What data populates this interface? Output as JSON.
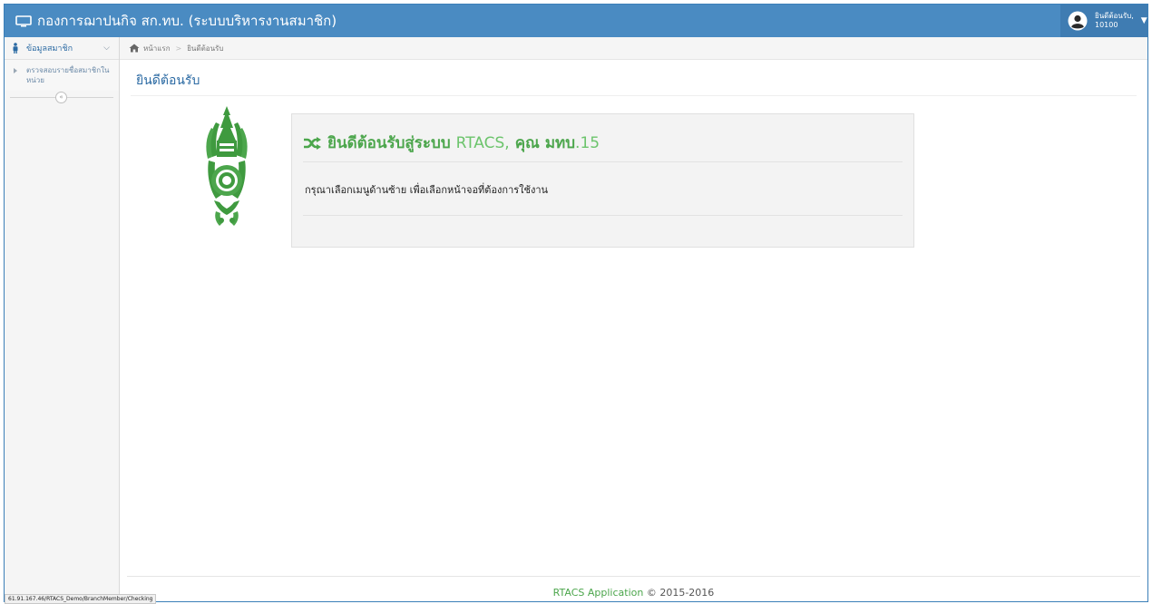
{
  "navbar": {
    "app_title": "กองการฌาปนกิจ สก.ทบ. (ระบบบริหารงานสมาชิก)",
    "user_greeting": "ยินดีต้อนรับ,",
    "user_id": "10100"
  },
  "sidebar": {
    "section_label": "ข้อมูลสมาชิก",
    "items": [
      {
        "label": "ตรวจสอบรายชื่อสมาชิกในหน่วย"
      }
    ],
    "collapse_glyph": "«"
  },
  "breadcrumb": {
    "home_label": "หน้าแรก",
    "separator": ">",
    "current_label": "ยินดีต้อนรับ"
  },
  "page": {
    "title": "ยินดีต้อนรับ"
  },
  "welcome": {
    "heading_prefix": "ยินดีต้อนรับสู่ระบบ",
    "system_name": "RTACS,",
    "user_prefix": "คุณ",
    "user_name": "มทบ",
    "user_suffix": ".15",
    "message": "กรุณาเลือกเมนูด้านซ้าย เพื่อเลือกหน้าจอที่ต้องการใช้งาน"
  },
  "footer": {
    "app_name": "RTACS Application",
    "copyright": "© 2015-2016"
  },
  "statusbar": {
    "url": "61.91.167.46/RTACS_Demo/BranchMember/Checking"
  },
  "colors": {
    "navbar": "#4a8bc2",
    "accent_green": "#4ca64c",
    "link_blue": "#2b6aa3"
  },
  "icons": {
    "brand": "monitor-icon",
    "user": "user-avatar-icon",
    "sidebar": "person-icon",
    "breadcrumb": "home-icon",
    "welcome": "shuffle-icon"
  }
}
